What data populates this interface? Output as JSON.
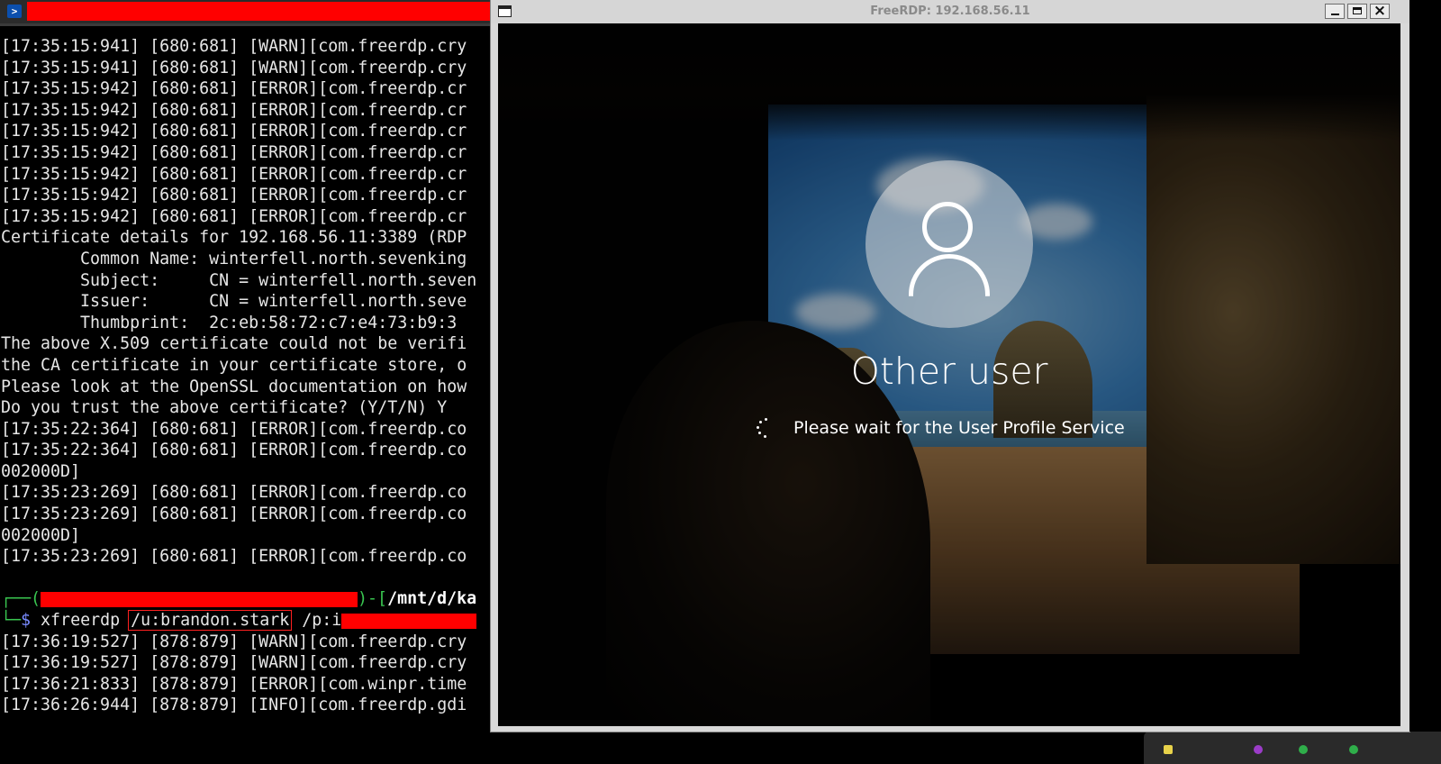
{
  "terminal": {
    "lines": [
      "[17:35:15:941] [680:681] [WARN][com.freerdp.cry",
      "[17:35:15:941] [680:681] [WARN][com.freerdp.cry",
      "[17:35:15:942] [680:681] [ERROR][com.freerdp.cr",
      "[17:35:15:942] [680:681] [ERROR][com.freerdp.cr",
      "[17:35:15:942] [680:681] [ERROR][com.freerdp.cr",
      "[17:35:15:942] [680:681] [ERROR][com.freerdp.cr",
      "[17:35:15:942] [680:681] [ERROR][com.freerdp.cr",
      "[17:35:15:942] [680:681] [ERROR][com.freerdp.cr",
      "[17:35:15:942] [680:681] [ERROR][com.freerdp.cr",
      "Certificate details for 192.168.56.11:3389 (RDP",
      "        Common Name: winterfell.north.sevenking",
      "        Subject:     CN = winterfell.north.seven",
      "        Issuer:      CN = winterfell.north.seve",
      "        Thumbprint:  2c:eb:58:72:c7:e4:73:b9:3",
      "The above X.509 certificate could not be verifi",
      "the CA certificate in your certificate store, o",
      "Please look at the OpenSSL documentation on how",
      "Do you trust the above certificate? (Y/T/N) Y",
      "[17:35:22:364] [680:681] [ERROR][com.freerdp.co",
      "[17:35:22:364] [680:681] [ERROR][com.freerdp.co",
      "002000D]",
      "[17:35:23:269] [680:681] [ERROR][com.freerdp.co",
      "[17:35:23:269] [680:681] [ERROR][com.freerdp.co",
      "002000D]",
      "[17:35:23:269] [680:681] [ERROR][com.freerdp.co",
      ""
    ],
    "prompt": {
      "top_prefix": "┌──(",
      "top_mid": ")-[",
      "path": "/mnt/d/ka",
      "bottom_prefix": "└─",
      "dollar": "$",
      "command": "xfreerdp",
      "user_arg": "/u:brandon.stark",
      "pass_arg": "/p:i"
    },
    "after_lines": [
      "[17:36:19:527] [878:879] [WARN][com.freerdp.cry",
      "[17:36:19:527] [878:879] [WARN][com.freerdp.cry",
      "[17:36:21:833] [878:879] [ERROR][com.winpr.time",
      "[17:36:26:944] [878:879] [INFO][com.freerdp.gdi"
    ],
    "tab_icon": "powershell-icon"
  },
  "rdp": {
    "title": "FreeRDP: 192.168.56.11",
    "minimize_icon": "minimize-icon",
    "maximize_icon": "maximize-icon",
    "close_label": "×"
  },
  "lockscreen": {
    "user_name": "Other user",
    "status_text": "Please wait for the User Profile Service"
  },
  "colors": {
    "prompt_green": "#39c550",
    "prompt_blue": "#7a8cff",
    "redaction": "#ff0000",
    "highlight_box": "#ff2020"
  }
}
